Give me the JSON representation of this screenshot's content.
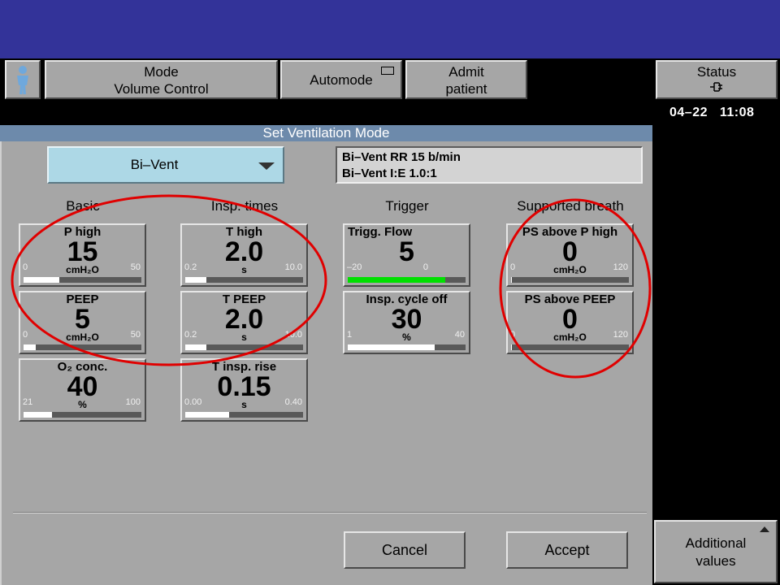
{
  "toolbar": {
    "mode_line1": "Mode",
    "mode_line2": "Volume Control",
    "automode": "Automode",
    "admit_line1": "Admit",
    "admit_line2": "patient",
    "status_line1": "Status",
    "status_icon": "plug-icon"
  },
  "datetime": {
    "date": "04–22",
    "time": "11:08"
  },
  "dialog": {
    "title": "Set Ventilation Mode",
    "selected_mode": "Bi–Vent",
    "info_line1": "Bi–Vent RR 15 b/min",
    "info_line2": "Bi–Vent I:E 1.0:1",
    "columns": [
      "Basic",
      "Insp. times",
      "Trigger",
      "Supported breath"
    ],
    "params": {
      "p_high": {
        "name": "P high",
        "value": "15",
        "min": "0",
        "max": "50",
        "unit": "cmH₂O",
        "level": 0.3
      },
      "peep": {
        "name": "PEEP",
        "value": "5",
        "min": "0",
        "max": "50",
        "unit": "cmH₂O",
        "level": 0.1
      },
      "o2": {
        "name": "O₂ conc.",
        "value": "40",
        "min": "21",
        "max": "100",
        "unit": "%",
        "level": 0.24
      },
      "t_high": {
        "name": "T high",
        "value": "2.0",
        "min": "0.2",
        "max": "10.0",
        "unit": "s",
        "level": 0.18
      },
      "t_peep": {
        "name": "T PEEP",
        "value": "2.0",
        "min": "0.2",
        "max": "10.0",
        "unit": "s",
        "level": 0.18
      },
      "t_insp_rise": {
        "name": "T insp. rise",
        "value": "0.15",
        "min": "0.00",
        "max": "0.40",
        "unit": "s",
        "level": 0.37
      },
      "trigg_flow": {
        "name": "Trigg. Flow",
        "value": "5",
        "min": "–20",
        "max": "0",
        "unit": "",
        "level": 0.83
      },
      "insp_cycle_off": {
        "name": "Insp. cycle off",
        "value": "30",
        "min": "1",
        "max": "40",
        "unit": "%",
        "level": 0.74
      },
      "ps_above_p_high": {
        "name": "PS above P high",
        "value": "0",
        "min": "0",
        "max": "120",
        "unit": "cmH₂O",
        "level": 0.01
      },
      "ps_above_peep": {
        "name": "PS above PEEP",
        "value": "0",
        "min": "0",
        "max": "120",
        "unit": "cmH₂O",
        "level": 0.01
      }
    },
    "cancel": "Cancel",
    "accept": "Accept"
  },
  "additional": {
    "line1": "Additional",
    "line2": "values"
  },
  "colors": {
    "top_band": "#333399",
    "panel": "#a6a6a6",
    "selector": "#add8e6",
    "title_bar": "#6d8aab",
    "annotation": "#e00000",
    "trigger_bar": "#00e000"
  }
}
